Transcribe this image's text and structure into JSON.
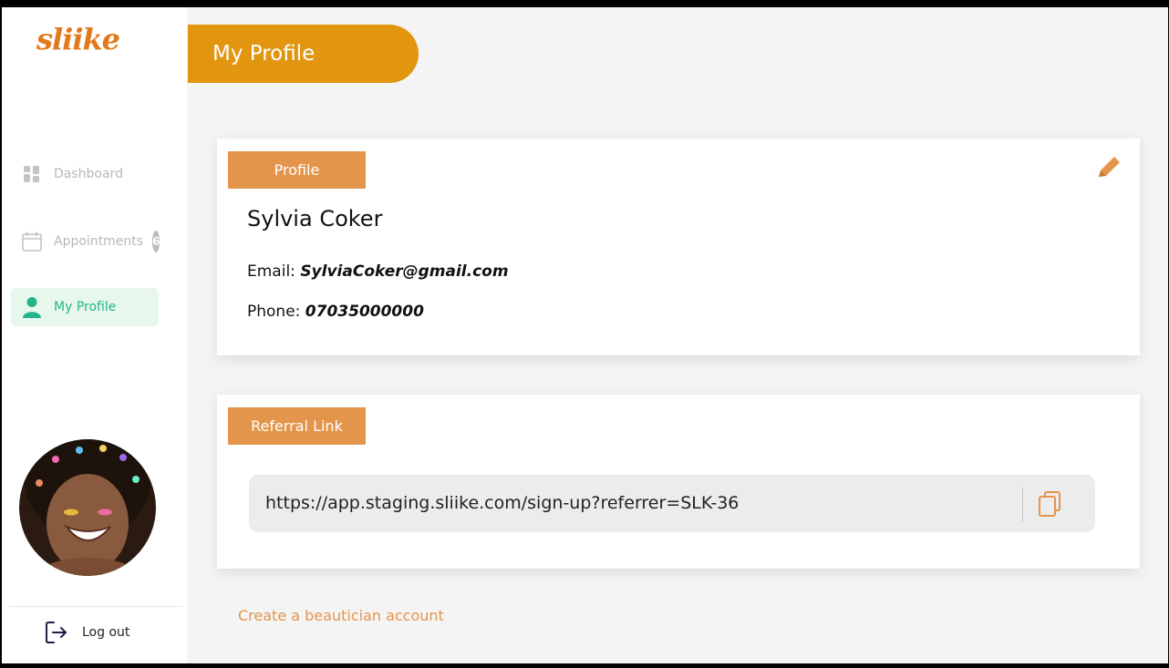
{
  "brand": {
    "logo": "sliike",
    "accent": "#e2960f",
    "tag_color": "#e4954c",
    "active_color": "#23b58a"
  },
  "header": {
    "title": "My Profile"
  },
  "sidebar": {
    "items": [
      {
        "label": "Dashboard",
        "icon": "dashboard-icon"
      },
      {
        "label": "Appointments",
        "icon": "calendar-icon",
        "badge": "6"
      },
      {
        "label": "My Profile",
        "icon": "user-icon",
        "active": true
      }
    ],
    "logout_label": "Log out"
  },
  "profile": {
    "tag": "Profile",
    "name": "Sylvia Coker",
    "email_label": "Email:",
    "email": "SylviaCoker@gmail.com",
    "phone_label": "Phone:",
    "phone": "07035000000"
  },
  "referral": {
    "tag": "Referral Link",
    "url": "https://app.staging.sliike.com/sign-up?referrer=SLK-36"
  },
  "footer_link": "Create a beautician account"
}
